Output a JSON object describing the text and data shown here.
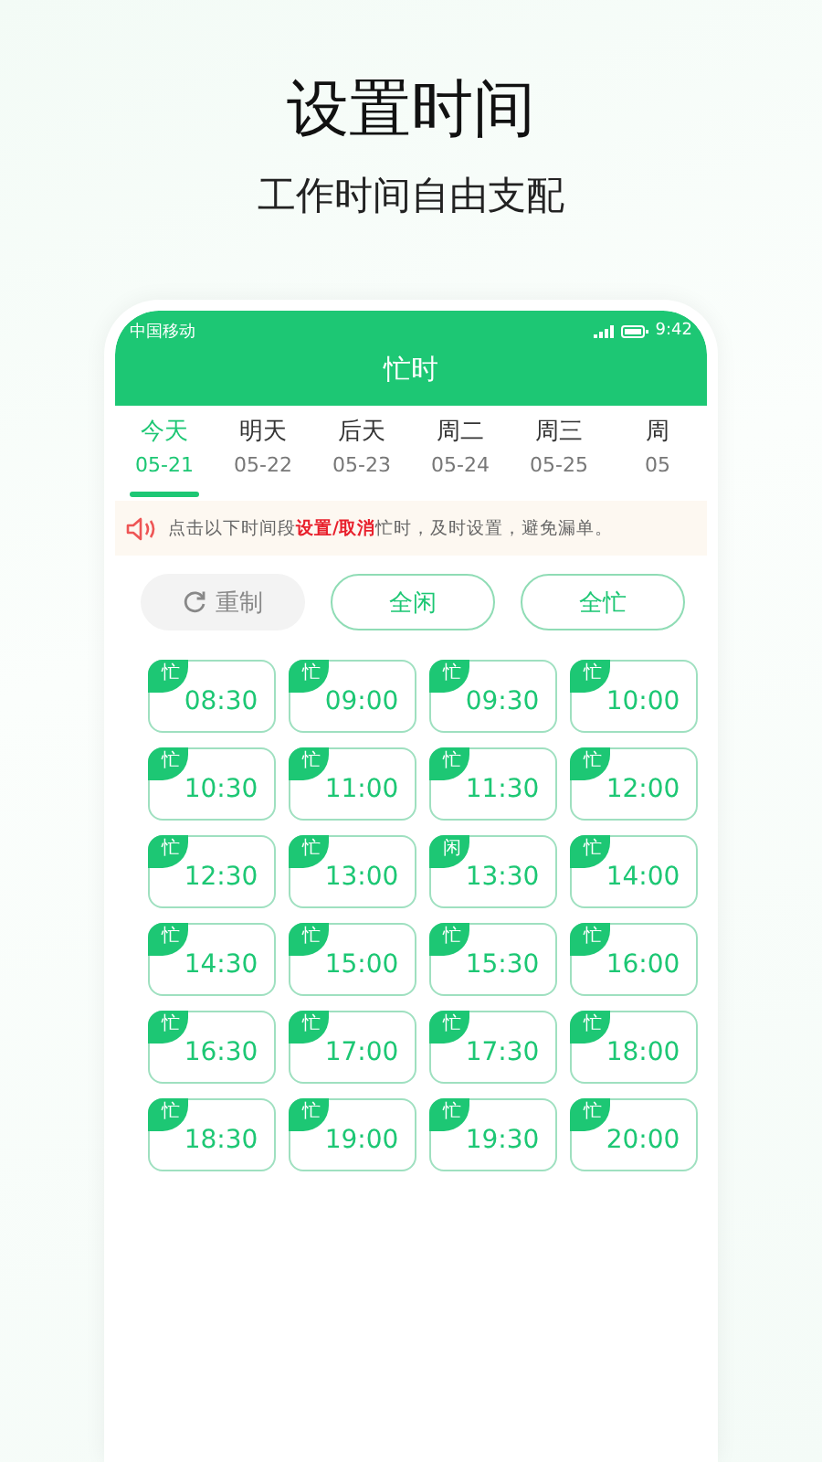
{
  "headline": "设置时间",
  "subtitle": "工作时间自由支配",
  "status_bar": {
    "carrier": "中国移动",
    "time": "9:42"
  },
  "title": "忙时",
  "tabs": [
    {
      "label": "今天",
      "date": "05-21",
      "selected": true
    },
    {
      "label": "明天",
      "date": "05-22",
      "selected": false
    },
    {
      "label": "后天",
      "date": "05-23",
      "selected": false
    },
    {
      "label": "周二",
      "date": "05-24",
      "selected": false
    },
    {
      "label": "周三",
      "date": "05-25",
      "selected": false
    },
    {
      "label": "周",
      "date": "05",
      "selected": false
    }
  ],
  "notice": "点击以下时间段**设置/取消**忙时，及时设置，避免漏单。",
  "actions": [
    {
      "kind": "reset",
      "label": "重制"
    },
    {
      "kind": "outline",
      "label": "全闲"
    },
    {
      "kind": "outline",
      "label": "全忙"
    }
  ],
  "slots": [
    {
      "tag": "忙",
      "time": "08:30"
    },
    {
      "tag": "忙",
      "time": "09:00"
    },
    {
      "tag": "忙",
      "time": "09:30"
    },
    {
      "tag": "忙",
      "time": "10:00"
    },
    {
      "tag": "忙",
      "time": "10:30"
    },
    {
      "tag": "忙",
      "time": "11:00"
    },
    {
      "tag": "忙",
      "time": "11:30"
    },
    {
      "tag": "忙",
      "time": "12:00"
    },
    {
      "tag": "忙",
      "time": "12:30"
    },
    {
      "tag": "忙",
      "time": "13:00"
    },
    {
      "tag": "闲",
      "time": "13:30"
    },
    {
      "tag": "忙",
      "time": "14:00"
    },
    {
      "tag": "忙",
      "time": "14:30"
    },
    {
      "tag": "忙",
      "time": "15:00"
    },
    {
      "tag": "忙",
      "time": "15:30"
    },
    {
      "tag": "忙",
      "time": "16:00"
    },
    {
      "tag": "忙",
      "time": "16:30"
    },
    {
      "tag": "忙",
      "time": "17:00"
    },
    {
      "tag": "忙",
      "time": "17:30"
    },
    {
      "tag": "忙",
      "time": "18:00"
    },
    {
      "tag": "忙",
      "time": "18:30"
    },
    {
      "tag": "忙",
      "time": "19:00"
    },
    {
      "tag": "忙",
      "time": "19:30"
    },
    {
      "tag": "忙",
      "time": "20:00"
    }
  ]
}
